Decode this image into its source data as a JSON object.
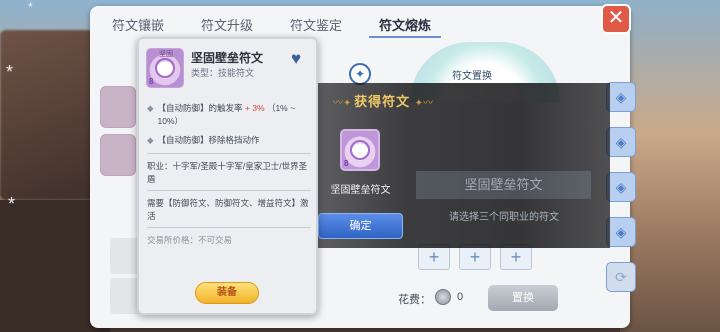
{
  "tabs": [
    {
      "label": "符文镶嵌"
    },
    {
      "label": "符文升级"
    },
    {
      "label": "符文鉴定"
    },
    {
      "label": "符文熔炼",
      "active": true
    }
  ],
  "close_icon": "✕",
  "tooltip": {
    "rune_name": "坚固壁垒符文",
    "rune_type": "类型：技能符文",
    "icon_level": "8",
    "icon_tag": "坚固",
    "favorite_icon": "heart-icon",
    "effects": [
      {
        "prefix": "【自动防御】的触发率",
        "highlight": "+ 3%",
        "suffix": "（1% ~ 10%）"
      },
      {
        "prefix": "【自动防御】移除格挡动作",
        "highlight": "",
        "suffix": ""
      }
    ],
    "job_label": "职业：十字军/圣殿十字军/皇家卫士/世界圣盾",
    "requirement": "需要【防御符文、防御符文、增益符文】激活",
    "trade_label": "交易所价格：不可交易",
    "equip_label": "装备"
  },
  "smelt": {
    "placement_label": "符文置换",
    "fee_label": "花费：",
    "fee_value": "0",
    "swap_label": "置换",
    "plus_slots": [
      "+",
      "+",
      "+"
    ]
  },
  "reward": {
    "title": "获得符文",
    "item_name": "坚固壁垒符文",
    "item_level": "8",
    "confirm_label": "确定",
    "bg_rune_name": "坚固壁垒符文",
    "bg_hint": "请选择三个同职业的符文"
  },
  "colors": {
    "accent_blue": "#2f63c4",
    "highlight_red": "#d84a3b",
    "gold": "#f0c866",
    "close_red": "#e05a48"
  }
}
